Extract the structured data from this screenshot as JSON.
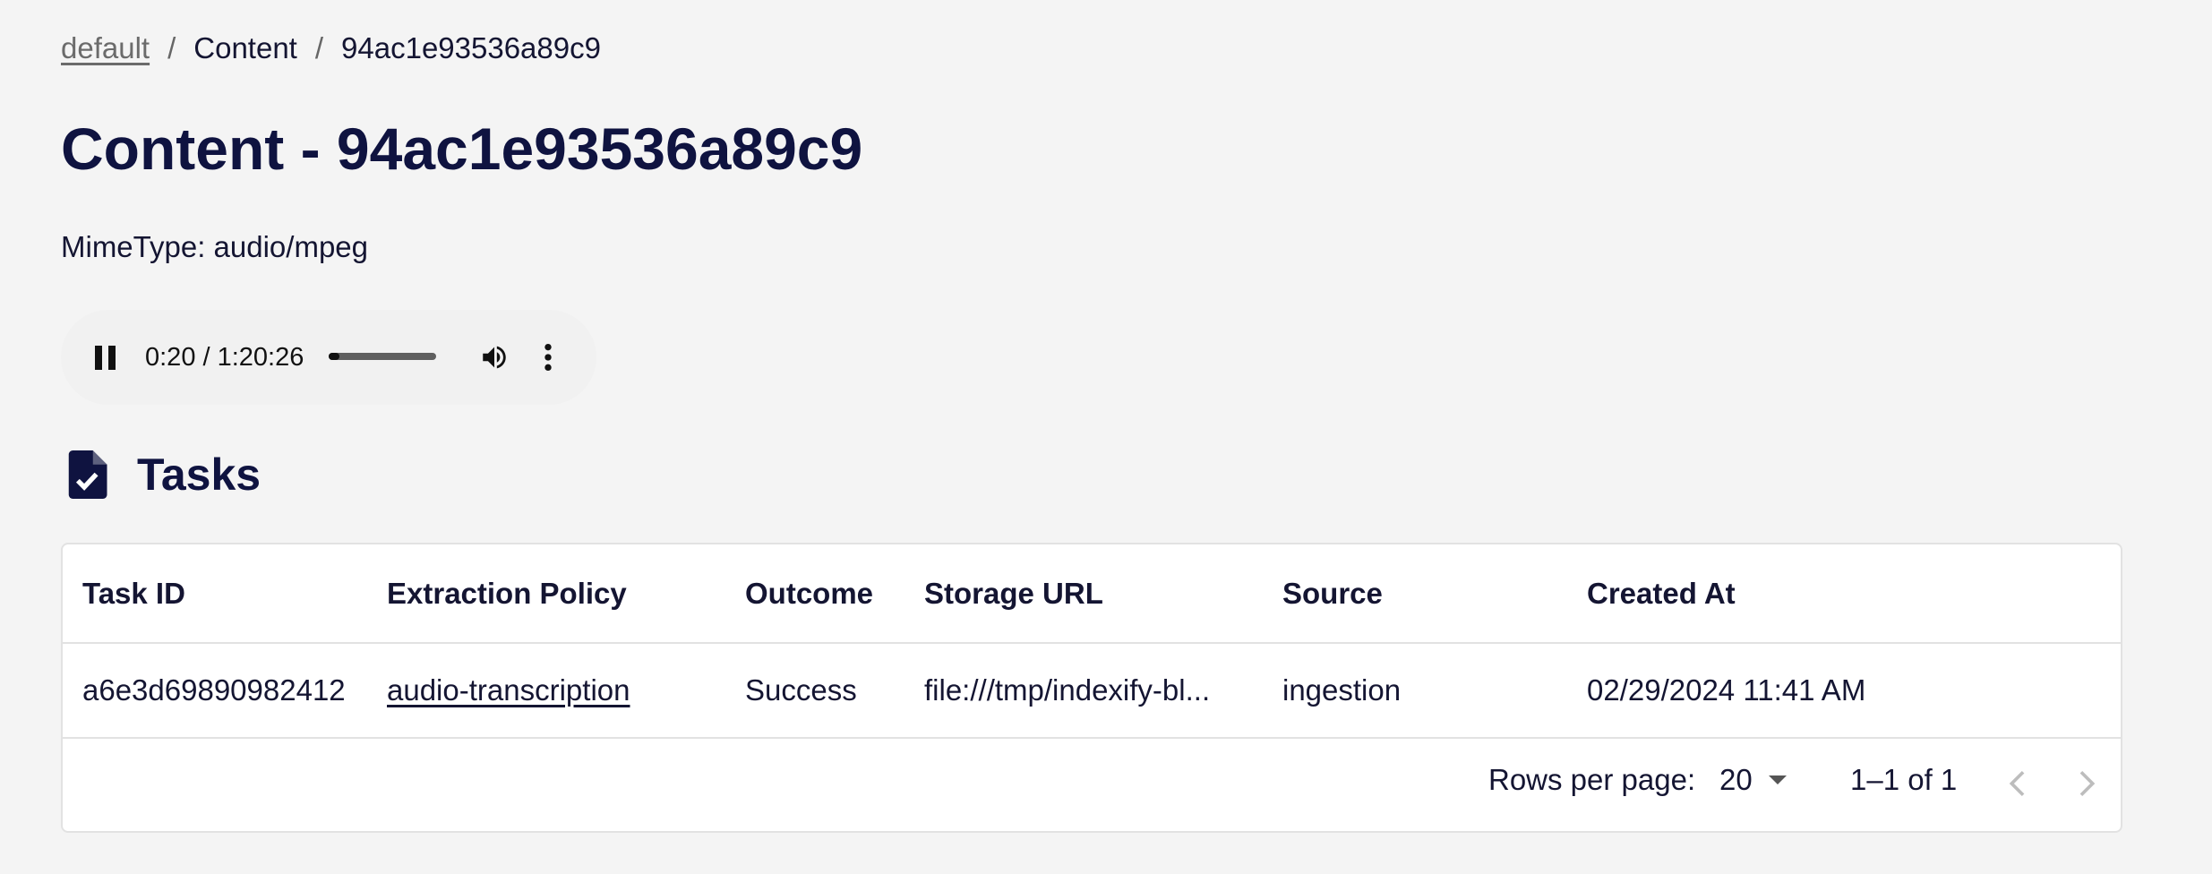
{
  "breadcrumb": {
    "namespace": "default",
    "section": "Content",
    "current": "94ac1e93536a89c9",
    "separator": "/"
  },
  "page": {
    "title": "Content - 94ac1e93536a89c9",
    "mimetype_label": "MimeType: audio/mpeg"
  },
  "audio": {
    "time_display": "0:20 / 1:20:26",
    "progress_fraction": 0.004,
    "state": "playing",
    "icons": [
      "pause-icon",
      "volume-icon",
      "more-vert-icon"
    ]
  },
  "tasks": {
    "heading": "Tasks",
    "icon": "task-document-check-icon",
    "columns": [
      "Task ID",
      "Extraction Policy",
      "Outcome",
      "Storage URL",
      "Source",
      "Created At"
    ],
    "rows": [
      {
        "task_id": "a6e3d69890982412",
        "extraction_policy": "audio-transcription",
        "outcome": "Success",
        "storage_url": "file:///tmp/indexify-bl...",
        "source": "ingestion",
        "created_at": "02/29/2024 11:41 AM"
      }
    ],
    "pagination": {
      "rows_per_page_label": "Rows per page:",
      "rows_per_page_value": "20",
      "range_label": "1–1 of 1"
    }
  },
  "colors": {
    "background": "#f4f4f4",
    "heading": "#0f1340",
    "card": "#ffffff",
    "border": "#e2e2e2"
  }
}
